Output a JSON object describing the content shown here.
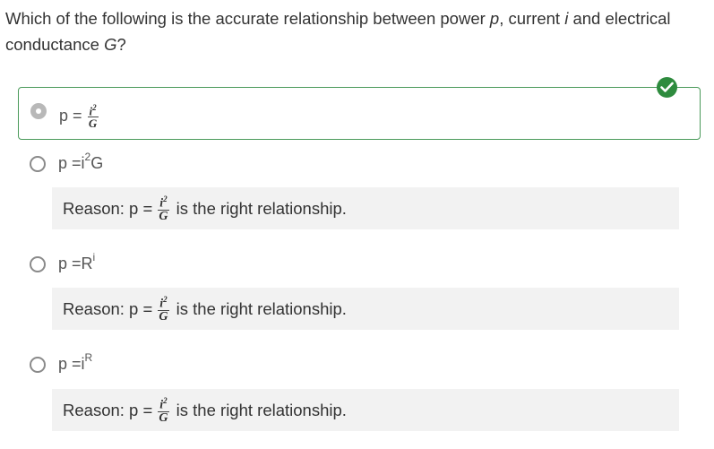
{
  "question": {
    "part1": "Which of the following is the accurate relationship between power ",
    "var_p": "p",
    "part2": ", current ",
    "var_i": "i",
    "part3": " and electrical conductance ",
    "var_G": "G",
    "part4": "?"
  },
  "options": [
    {
      "lhs": "p = ",
      "num_base": "i",
      "num_exp": "2",
      "den": "G",
      "selected": true,
      "correct": true
    },
    {
      "lhs": "p = ",
      "base": "i",
      "exp": "2",
      "tail": "G"
    },
    {
      "lhs": "p = ",
      "base": "R",
      "exp": "i",
      "tail": ""
    },
    {
      "lhs": "p = ",
      "base": "i",
      "exp": "R",
      "tail": ""
    }
  ],
  "reason": {
    "prefix": "Reason: p = ",
    "num_base": "i",
    "num_exp": "2",
    "den": "G",
    "suffix": "is the right relationship."
  },
  "colors": {
    "correct": "#2e8b3e",
    "reason_bg": "#f2f2f2",
    "selected_border": "#4a9a5a"
  },
  "icons": {
    "correct_marker": "check-circle-icon"
  }
}
